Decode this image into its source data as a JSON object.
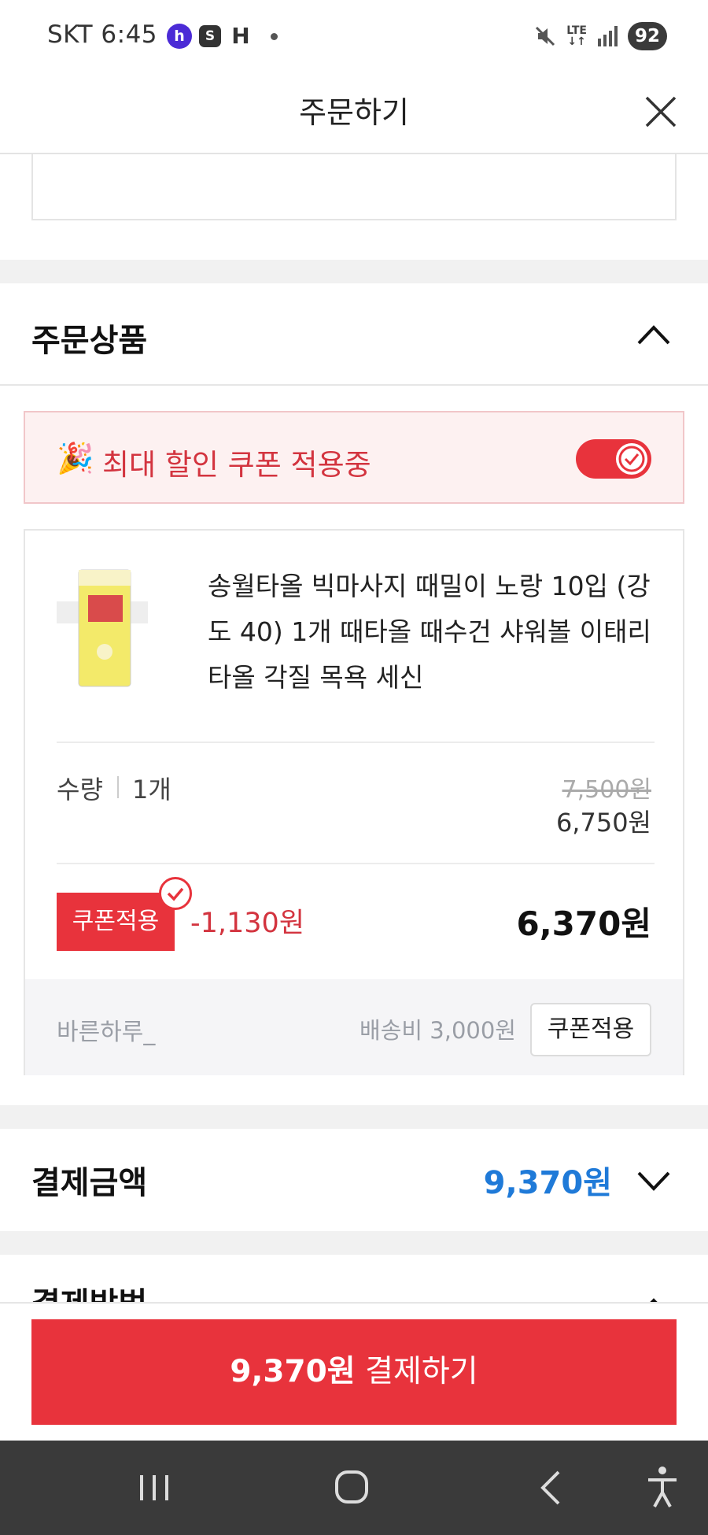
{
  "status_bar": {
    "carrier": "SKT",
    "time": "6:45",
    "app_icons": [
      "h",
      "S",
      "H"
    ],
    "network": "LTE",
    "battery": "92"
  },
  "header": {
    "title": "주문하기"
  },
  "order_items": {
    "title": "주문상품",
    "coupon_banner": {
      "text": "최대 할인 쿠폰 적용중",
      "toggle_on": true
    },
    "product": {
      "name": "송월타올 빅마사지 때밀이 노랑 10입 (강도 40) 1개 때타올 때수건 샤워볼 이태리타올 각질 목욕 세신",
      "quantity_label": "수량",
      "quantity_value": "1개",
      "original_price": "7,500원",
      "sale_price": "6,750원",
      "coupon_tag": "쿠폰적용",
      "discount": "-1,130원",
      "final_price": "6,370원",
      "seller": "바른하루_",
      "shipping": "배송비 3,000원",
      "coupon_button": "쿠폰적용"
    }
  },
  "payment": {
    "title": "결제금액",
    "amount": "9,370원"
  },
  "payment_method": {
    "title": "결제방법"
  },
  "pay_button": {
    "amount": "9,370원",
    "label": "결제하기"
  },
  "colors": {
    "accent_red": "#e8333c",
    "link_blue": "#1f7ad8"
  }
}
